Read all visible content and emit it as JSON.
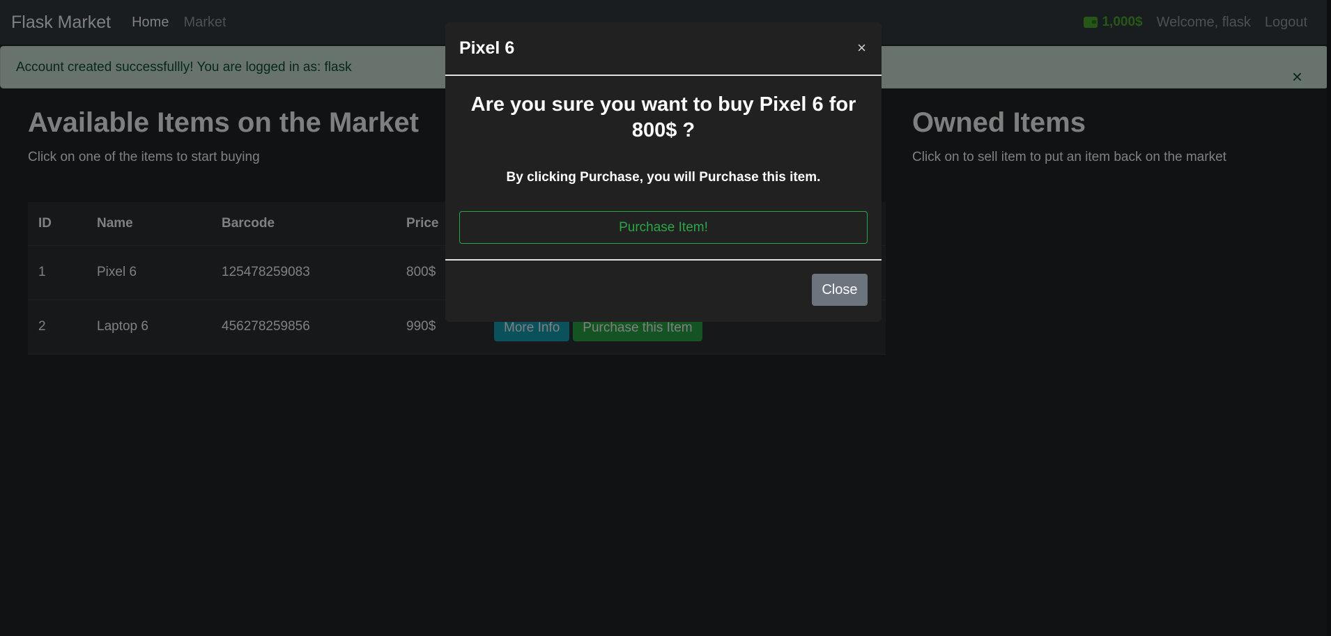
{
  "navbar": {
    "brand": "Flask Market",
    "links": [
      "Home",
      "Market"
    ],
    "budget": "1,000$",
    "welcome": "Welcome, flask",
    "logout": "Logout"
  },
  "alert": {
    "message": "Account created successfullly! You are logged in as: flask",
    "close": "×"
  },
  "market": {
    "title": "Available Items on the Market",
    "subtitle": "Click on one of the items to start buying",
    "columns": [
      "ID",
      "Name",
      "Barcode",
      "Price"
    ],
    "rows": [
      {
        "id": "1",
        "name": "Pixel 6",
        "barcode": "125478259083",
        "price": "800$"
      },
      {
        "id": "2",
        "name": "Laptop 6",
        "barcode": "456278259856",
        "price": "990$"
      }
    ],
    "more_info_label": "More Info",
    "purchase_label": "Purchase this Item"
  },
  "owned": {
    "title": "Owned Items",
    "subtitle": "Click on to sell item to put an item back on the market"
  },
  "modal": {
    "title": "Pixel 6",
    "close_x": "×",
    "question": "Are you sure you want to buy Pixel 6 for 800$ ?",
    "note": "By clicking Purchase, you will Purchase this item.",
    "purchase_button": "Purchase Item!",
    "close_button": "Close"
  },
  "colors": {
    "accent_success": "#28a745",
    "accent_info": "#17a2b8",
    "budget": "#4caf2f"
  }
}
